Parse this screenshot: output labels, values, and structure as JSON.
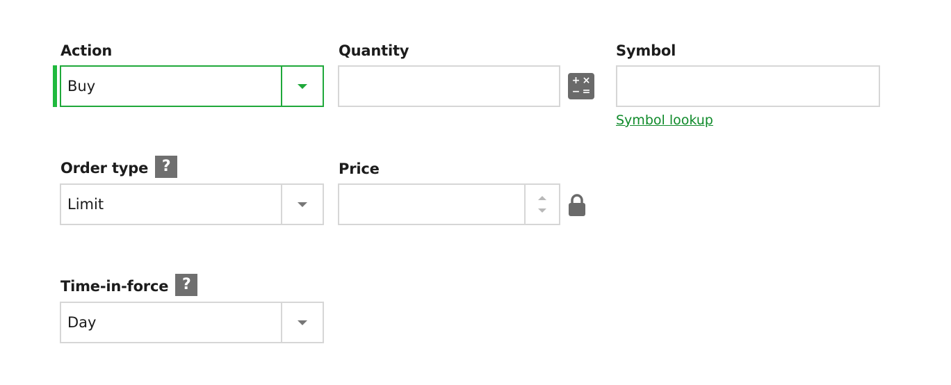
{
  "action": {
    "label": "Action",
    "value": "Buy",
    "icon": "chevron-down-icon",
    "accent": "#1fa83a"
  },
  "quantity": {
    "label": "Quantity",
    "value": "",
    "calc_icon": "calculator-icon",
    "calc_glyphs": [
      "+",
      "×",
      "−",
      "="
    ]
  },
  "symbol": {
    "label": "Symbol",
    "value": "",
    "lookup_link": "Symbol lookup"
  },
  "order_type": {
    "label": "Order type",
    "help": "?",
    "value": "Limit",
    "icon": "chevron-down-icon"
  },
  "price": {
    "label": "Price",
    "value": "",
    "lock_icon": "lock-icon"
  },
  "time_in_force": {
    "label": "Time-in-force",
    "help": "?",
    "value": "Day",
    "icon": "chevron-down-icon"
  },
  "colors": {
    "accent_green": "#1fb93d",
    "link_green": "#0f8a2a",
    "border": "#d6d6d6",
    "icon_gray": "#6f6f6f"
  }
}
